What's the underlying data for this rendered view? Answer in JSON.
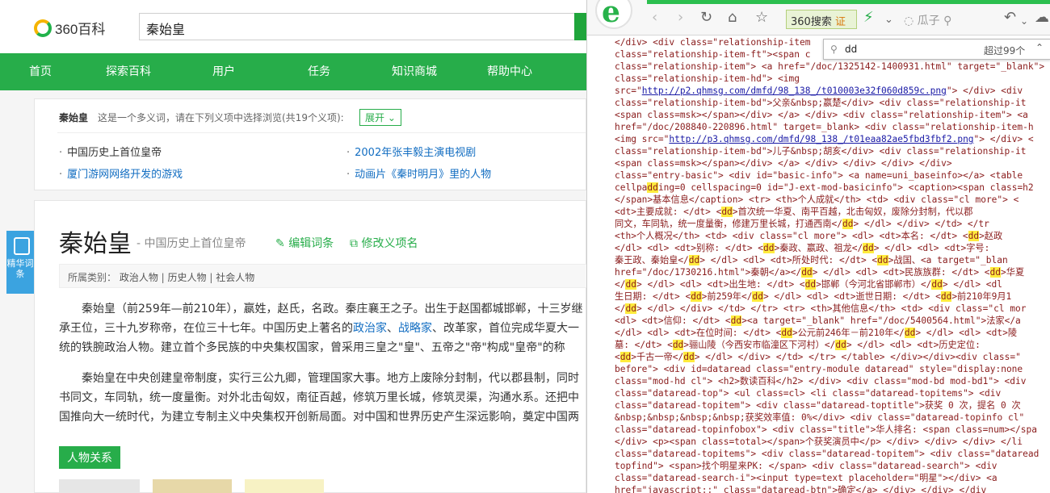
{
  "site": {
    "logo_text": "360百科",
    "search_value": "秦始皇"
  },
  "nav": [
    "首页",
    "探索百科",
    "用户",
    "任务",
    "知识商城",
    "帮助中心"
  ],
  "polysemy": {
    "label": "秦始皇",
    "hint": "这是一个多义词，请在下列义项中选择浏览(共19个义项):",
    "expand": "展开",
    "items": [
      "中国历史上首位皇帝",
      "2002年张丰毅主演电视剧",
      "厦门游网网络开发的游戏",
      "动画片《秦时明月》里的人物"
    ]
  },
  "badge": "精华词条",
  "article": {
    "title": "秦始皇",
    "subtitle": "- 中国历史上首位皇帝",
    "edit": "编辑词条",
    "modify": "修改义项名",
    "categories_label": "所属类别：",
    "categories": [
      "政治人物",
      "历史人物",
      "社会人物"
    ],
    "p1a": "秦始皇（前259年—前210年），嬴姓，赵氏，名政。秦庄襄王之子。出生于赵国都城邯郸，十三岁继承王位，三十九岁称",
    "p1b": "帝，在位三十七年。中国历史上著名的",
    "p1_link1": "政治家",
    "p1_sep": "、",
    "p1_link2": "战略家",
    "p1c": "、改革家，首位完成华夏大一统的铁腕政治人物。建立首个多民族的中央集",
    "p1d": "权国家，曾采用三皇之\"皇\"、五帝之\"帝\"构成\"皇帝\"的称号，是古今中外第一个称皇帝的封建王朝君主。",
    "p2a": "秦始皇在中央创建皇帝制度，实行三公九卿，管理国家大事。地方上废除分封制，代以郡县制，同时书同文，车同轨，统一度",
    "p2b": "量衡。对外北击匈奴，南征百越，修筑万里长城，修筑灵渠，沟通水系。还把中国推向大一统时代，为建立专制主义中央集权",
    "p2c": "开创新局面。对中国和世界历史产生深远影响，奠定中国两千余年政治制度基本格局，他被明代思想家李贽誉为\"千古一帝\"。",
    "relation_header": "人物关系"
  },
  "browser": {
    "search_engine": "360搜索",
    "search_badge": "证",
    "url_hint": "瓜子",
    "find_query": "dd",
    "find_count": "超过99个"
  },
  "source_lines": [
    "</div> <div class=\"relationship-item",
    "class=\"relationship-item-ft\"><span c",
    "class=\"relationship-item\"> <a href=\"/doc/1325142-1400931.html\" target=\"_blank\">",
    "class=\"relationship-item-hd\"> <img",
    "src=\"http://p2.qhmsg.com/dmfd/98_138_/t010003e32f060d859c.png\"> </div> <div",
    "class=\"relationship-item-bd\">父亲&nbsp;嬴楚</div> <div class=\"relationship-it",
    "<span class=msk></span></div> </a> </div> <div class=\"relationship-item\"> <a",
    "href=\"/doc/208840-220896.html\" target=_blank> <div class=\"relationship-item-h",
    "<img src=\"http://p3.qhmsg.com/dmfd/98_138_/t01eaa82ae5fbd3fbf2.png\"> </div> <",
    "class=\"relationship-item-bd\">儿子&nbsp;胡亥</div> <div class=\"relationship-it",
    "<span class=msk></span></div> </a> </div> </div> </div> </div>",
    "class=\"entry-basic\"> <div id=\"basic-info\"> <a name=uni_baseinfo></a> <table",
    "cellpadding=0 cellspacing=0 id=\"J-ext-mod-basicinfo\"> <caption><span class=h2",
    "</span>基本信息</caption> <tr> <th>个人成就</th> <td> <div class=\"cl more\"> <",
    "<dt>主要成就: </dt> <dd>首次统一华夏、南平百越，北击匈奴，废除分封制，代以郡",
    "同文，车同轨，统一度量衡，修建万里长城，打通西南</dd> </dl> </div> </td> </tr",
    "<th>个人概况</th> <td> <div class=\"cl more\"> <dl> <dt>本名: </dt> <dd>赵政",
    "</dl> <dl> <dt>别称: </dt> <dd>秦政、嬴政、祖龙</dd> </dl> <dl> <dt>字号:",
    "秦王政、秦始皇</dd> </dl> <dl> <dt>所处时代: </dt> <dd>战国、<a target=\"_blan",
    "href=\"/doc/1730216.html\">秦朝</a></dd> </dl> <dl> <dt>民族族群: </dt> <dd>华夏",
    "</dd> </dl> <dl> <dt>出生地: </dt> <dd>邯郸（今河北省邯郸市）</dd> </dl> <dl",
    "生日期: </dt> <dd>前259年</dd> </dl> <dl> <dt>逝世日期: </dt> <dd>前210年9月1",
    "</dd> </dl> </div> </td> </tr> <tr> <th>其他信息</th> <td> <div class=\"cl mor",
    "<dl> <dt>信仰: </dt> <dd><a target=\"_blank\" href=\"/doc/5400564.html\">法家</a",
    "</dl> <dl> <dt>在位时间: </dt> <dd>公元前246年－前210年</dd> </dl> <dl> <dt>陵",
    "墓: </dt> <dd>骊山陵（今西安市临潼区下河村）</dd> </dl> <dl> <dt>历史定位:",
    "<dd>千古一帝</dd> </dl> </div> </td> </tr> </table> </div></div><div class=\"",
    "before\"> <div id=dataread class=\"entry-module dataread\" style=\"display:none",
    "class=\"mod-hd cl\"> <h2>数读百科</h2> </div> <div class=\"mod-bd mod-bd1\"> <div",
    "class=\"dataread-top\"> <ul class=cl> <li class=\"dataread-topitems\"> <div",
    "class=\"dataread-topitem\"> <div class=\"dataread-toptitle\">获奖 0 次，提名 0 次",
    "&nbsp;&nbsp;&nbsp;&nbsp;获奖效率值: 0%</div> <div class=\"dataread-topinfo cl\"",
    "class=\"dataread-topinfobox\"> <div class=\"title\">华人排名: <span class=num></spa",
    "</div> <p><span class=total></span>个获奖演员中</p> </div> </div> </div> </li",
    "class=\"dataread-topitems\"> <div class=\"dataread-topitem\"> <div class=\"dataread",
    "topfind\"> <span>找个明星来PK: </span> <div class=\"dataread-search\"> <div",
    "class=\"dataread-search-i\"><input type=text placeholder=\"明星\"></div> <a",
    "href=\"javascript:;\" class=\"dataread-btn\">确定</a> </div> </div> </div"
  ]
}
